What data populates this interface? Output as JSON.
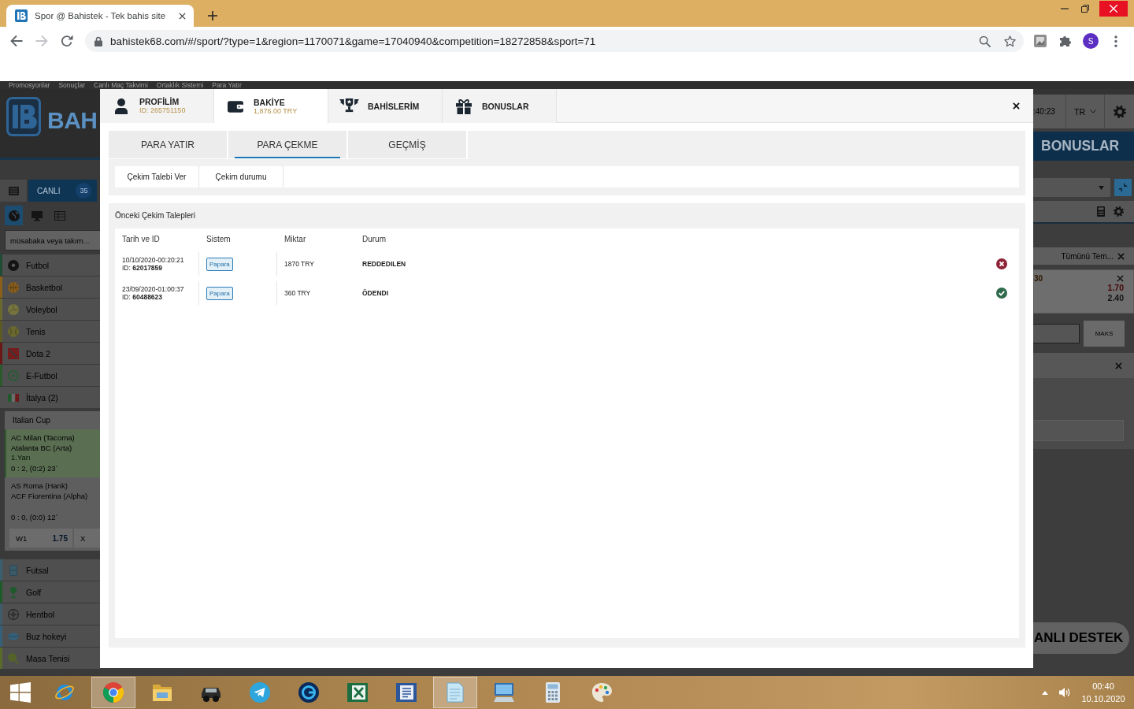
{
  "browser": {
    "tab_title": "Spor @ Bahistek - Tek bahis site",
    "nav_buttons": [
      {
        "kind": "back",
        "disabled": false
      },
      {
        "kind": "forward",
        "disabled": true
      },
      {
        "kind": "reload",
        "disabled": false
      }
    ],
    "url": "bahistek68.com/#/sport/?type=1&region=1170071&game=17040940&competition=18272858&sport=71",
    "profile_initial": "S"
  },
  "page": {
    "top_links": [
      "Promosyonlar",
      "Sonuçlar",
      "Canlı Maç Takvimi",
      "Ortaklık Sistemi",
      "Para Yatır"
    ],
    "logo_text": "BAH",
    "live_tab": {
      "label": "CANLI",
      "count": "35"
    },
    "view_buttons": [
      {
        "kind": "globe",
        "selected": true
      },
      {
        "kind": "monitor",
        "selected": false
      },
      {
        "kind": "grid",
        "selected": false
      }
    ],
    "search": {
      "placeholder": "müsabaka veya takım..."
    },
    "sports": [
      {
        "name": "Futbol",
        "kind": "soccer",
        "color": "#1f4a33"
      },
      {
        "name": "Basketbol",
        "kind": "basketball",
        "color": "#8a5f17"
      },
      {
        "name": "Voleybol",
        "kind": "volleyball",
        "color": "#6b6a2e"
      },
      {
        "name": "Tenis",
        "kind": "tennis",
        "color": "#5d5a26"
      },
      {
        "name": "Dota 2",
        "kind": "esport",
        "color": "#6b1717"
      },
      {
        "name": "E-Futbol",
        "kind": "efootball",
        "color": "#2a5a2a"
      }
    ],
    "region": {
      "name": "İtalya (2)",
      "competition": "Italian Cup",
      "matches": [
        {
          "teams": [
            "AC Milan (Tacoma)",
            "Atalanta BC (Arta)"
          ],
          "period": "1.Yarı",
          "score": "0 : 2, (0:2) 23`",
          "selected": true
        },
        {
          "teams": [
            "AS Roma (Hank)",
            "ACF Fiorentina (Alpha)"
          ],
          "score": "0 : 0, (0:0) 12`",
          "selected": false,
          "odds": [
            {
              "label": "W1",
              "value": "1.75"
            },
            {
              "label": "X"
            }
          ]
        }
      ]
    },
    "more_sports": [
      {
        "name": "Futsal",
        "kind": "futsal",
        "color": "#3a6070"
      },
      {
        "name": "Golf",
        "kind": "golf",
        "color": "#1e5a2a"
      },
      {
        "name": "Hentbol",
        "kind": "handball",
        "color": "#3f5a6a"
      },
      {
        "name": "Buz hokeyi",
        "kind": "hockey",
        "color": "#35607a"
      },
      {
        "name": "Masa Tenisi",
        "kind": "tabletennis",
        "color": "#5a6a2a"
      }
    ],
    "right_panel": {
      "clock": ":40:23",
      "language": "TR",
      "bonus_button": "BONUSLAR",
      "clear_all": "Tümünü Tem...",
      "bet": {
        "time": "30",
        "odds": [
          {
            "value": "1.70",
            "color": "#4a0808"
          },
          {
            "value": "2.40",
            "color": "#141414"
          }
        ]
      },
      "max_button": "MAKS",
      "support_button": "ANLI DESTEK"
    }
  },
  "modal": {
    "tabs": [
      {
        "label": "PROFİLİM",
        "detail": "ID: 265751150",
        "kind": "user",
        "selected": false
      },
      {
        "label": "BAKİYE",
        "detail": "1,876.00 TRY",
        "kind": "wallet",
        "selected": true
      },
      {
        "label": "BAHİSLERİM",
        "kind": "trophy",
        "selected": false
      },
      {
        "label": "BONUSLAR",
        "kind": "gift",
        "selected": false
      }
    ],
    "section_tabs": [
      {
        "label": "PARA YATIR",
        "selected": false
      },
      {
        "label": "PARA ÇEKME",
        "selected": true
      },
      {
        "label": "GEÇMİŞ",
        "selected": false
      }
    ],
    "actions": [
      "Çekim Talebi Ver",
      "Çekim durumu"
    ],
    "history": {
      "title": "Önceki Çekim Talepleri",
      "columns": [
        "Tarih ve ID",
        "Sistem",
        "Miktar",
        "Durum"
      ],
      "rows": [
        {
          "date": "10/10/2020-00:20:21",
          "id": "ID: **62017859**",
          "system": "Papara",
          "amount": "1870 TRY",
          "status": "REDDEDILEN",
          "kind": "rejected"
        },
        {
          "date": "23/09/2020-01:00:37",
          "id": "ID: **60488623**",
          "system": "Papara",
          "amount": "360 TRY",
          "status": "ÖDENDI",
          "kind": "paid"
        }
      ]
    }
  },
  "taskbar": {
    "apps": [
      {
        "kind": "ie",
        "active": false
      },
      {
        "kind": "chrome",
        "active": true
      },
      {
        "kind": "folder",
        "active": false
      },
      {
        "kind": "car",
        "active": false
      },
      {
        "kind": "telegram",
        "active": false
      },
      {
        "kind": "ring",
        "active": false
      },
      {
        "kind": "spreadsheet",
        "active": false
      },
      {
        "kind": "document",
        "active": false
      },
      {
        "kind": "notepad",
        "active": true
      },
      {
        "kind": "computer",
        "active": false
      },
      {
        "kind": "calculator",
        "active": false
      },
      {
        "kind": "paint",
        "active": false
      }
    ],
    "time": "00:40",
    "date": "10.10.2020"
  }
}
